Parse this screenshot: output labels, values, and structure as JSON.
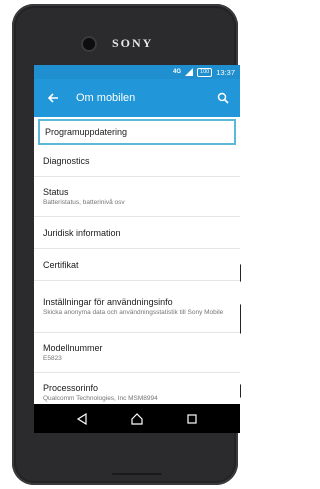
{
  "device": {
    "brand": "SONY"
  },
  "statusbar": {
    "network": "4G",
    "battery": "100",
    "time": "13:37"
  },
  "appbar": {
    "title": "Om mobilen"
  },
  "items": [
    {
      "label": "Programuppdatering",
      "sub": ""
    },
    {
      "label": "Diagnostics",
      "sub": ""
    },
    {
      "label": "Status",
      "sub": "Batteristatus, batterinivå osv"
    },
    {
      "label": "Juridisk information",
      "sub": ""
    },
    {
      "label": "Certifikat",
      "sub": ""
    },
    {
      "label": "Inställningar för användningsinfo",
      "sub": "Skicka anonyma data och användningsstatistik till Sony Mobile"
    },
    {
      "label": "Modellnummer",
      "sub": "E5823"
    },
    {
      "label": "Processorinfo",
      "sub": "Qualcomm Technologies, Inc MSM8994"
    }
  ],
  "icons": {
    "back": "arrow-left-icon",
    "search": "search-icon",
    "nav_back": "triangle-back-icon",
    "nav_home": "home-icon",
    "nav_recents": "square-recents-icon"
  },
  "colors": {
    "statusbar": "#1f8fcf",
    "appbar": "#2196d9",
    "selection_border": "#5bb8d9"
  }
}
